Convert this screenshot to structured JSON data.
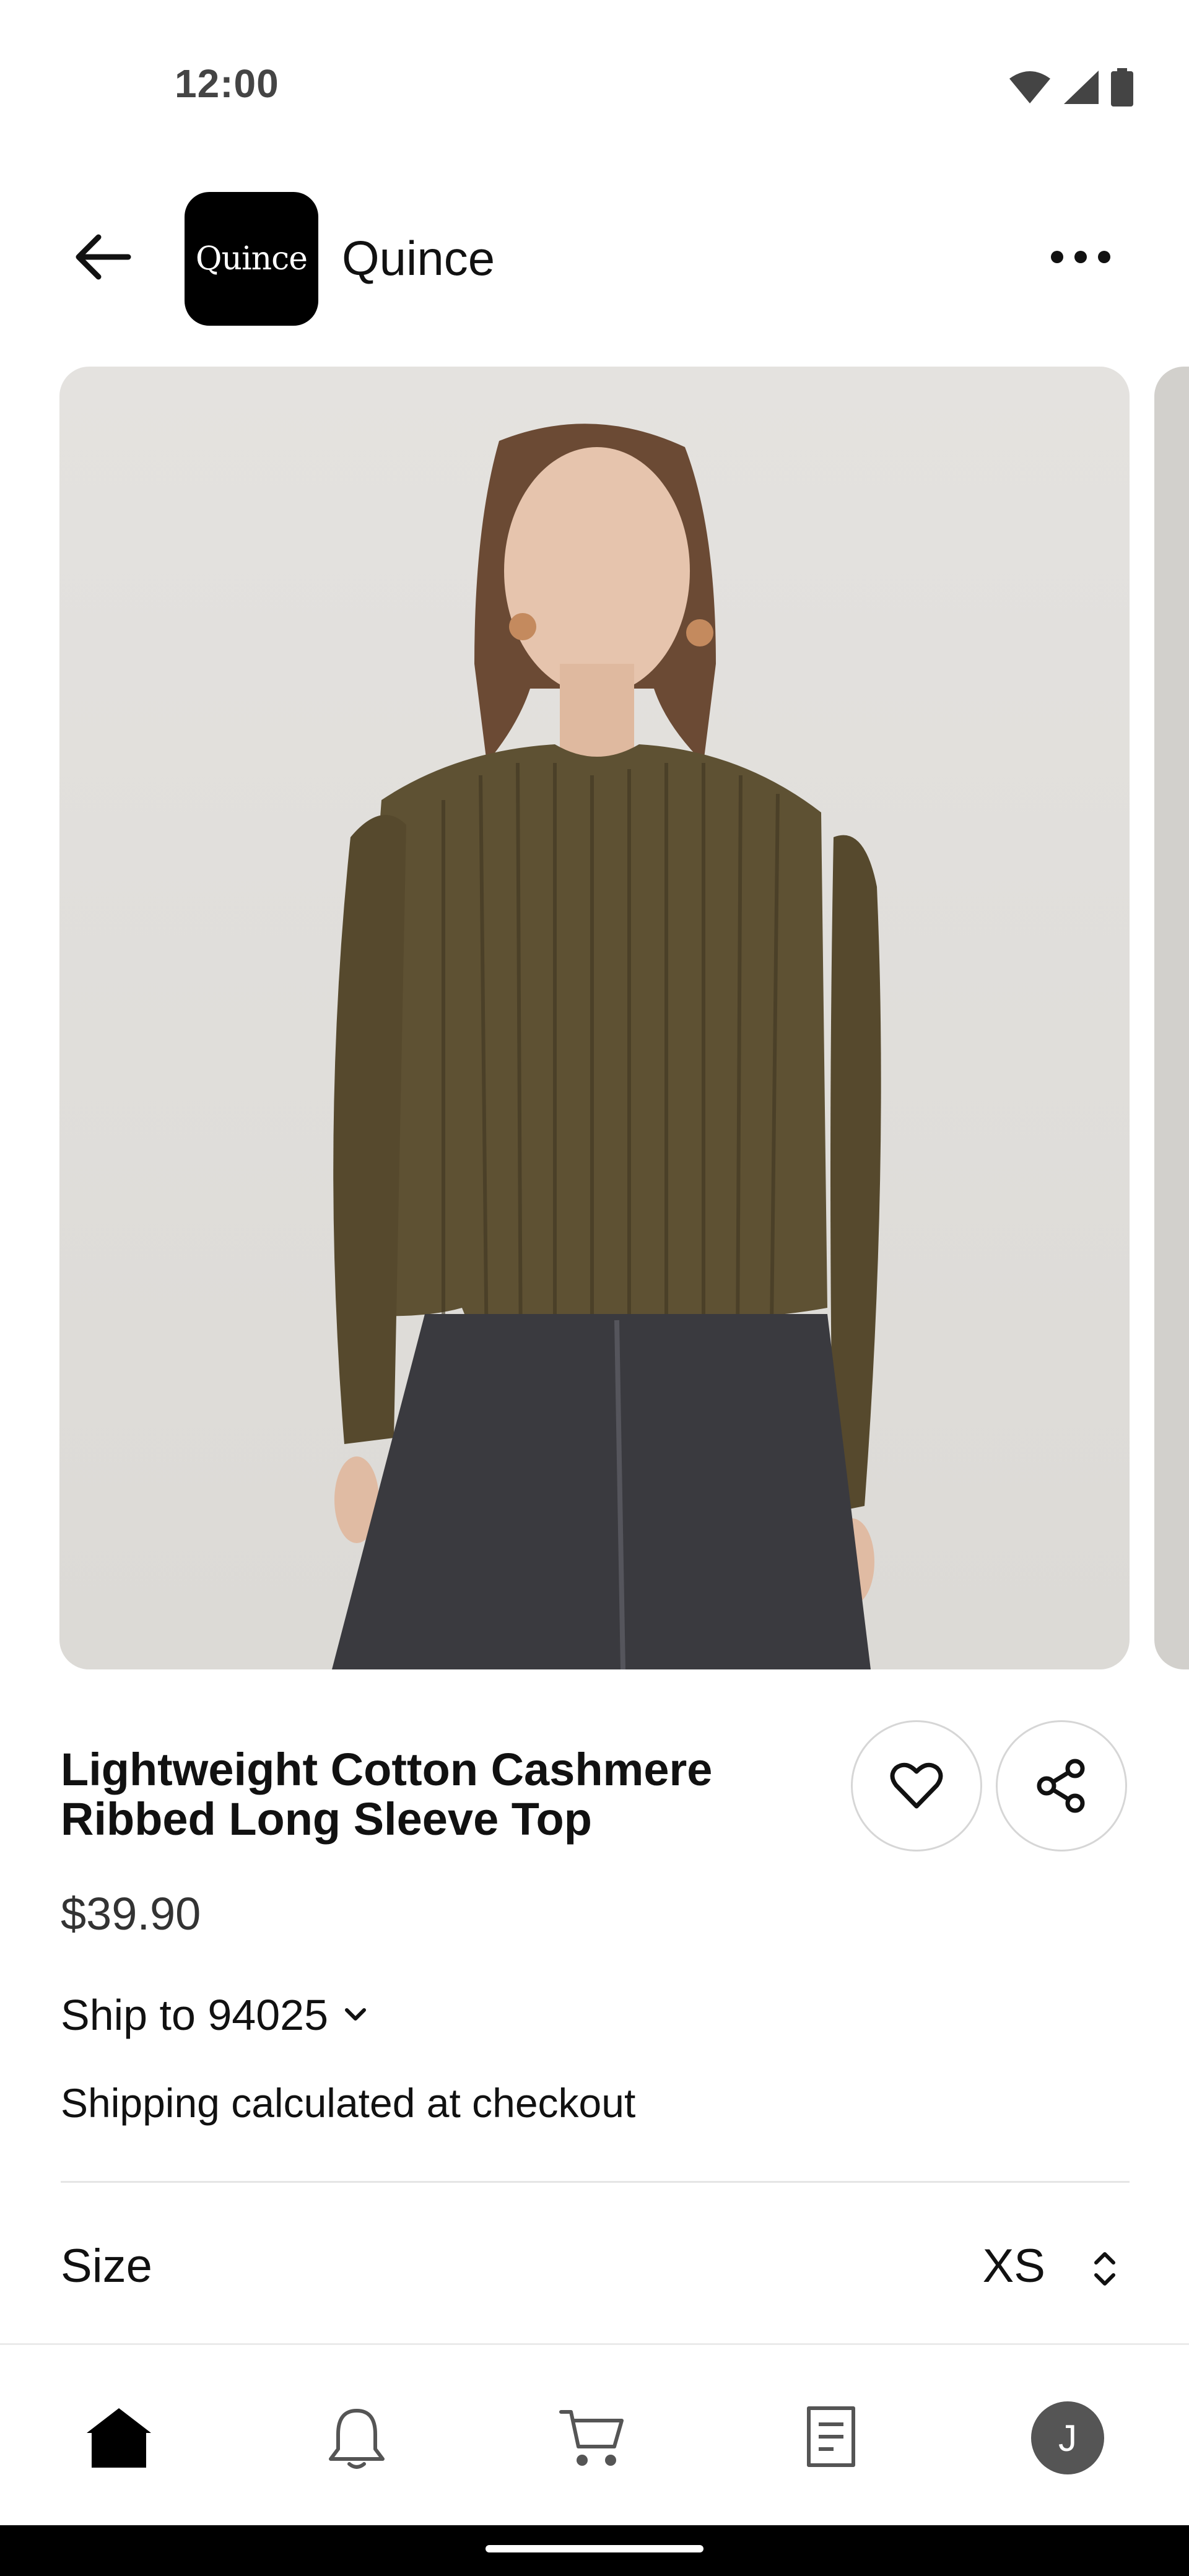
{
  "status_bar": {
    "time": "12:00",
    "icons": [
      "wifi-icon",
      "signal-icon",
      "battery-icon"
    ]
  },
  "header": {
    "back_icon": "arrow-left-icon",
    "logo_text": "Quince",
    "shop_name": "Quince",
    "more_icon": "more-horizontal-icon"
  },
  "product": {
    "image_subject": "product photo",
    "title": "Lightweight Cotton Cashmere Ribbed Long Sleeve Top",
    "price": "$39.90",
    "ship_to_label": "Ship to 94025",
    "shipping_note": "Shipping calculated at checkout",
    "size_label": "Size",
    "size_value": "XS"
  },
  "actions": {
    "favorite_icon": "heart-icon",
    "share_icon": "share-icon"
  },
  "bottom_nav": {
    "items": [
      {
        "icon": "home-icon",
        "active": true
      },
      {
        "icon": "bell-icon",
        "active": false
      },
      {
        "icon": "cart-icon",
        "active": false
      },
      {
        "icon": "receipt-icon",
        "active": false
      },
      {
        "icon": "avatar",
        "active": false
      }
    ],
    "avatar_initial": "J"
  },
  "colors": {
    "background": "#ffffff",
    "text": "#111111",
    "muted_text": "#333333",
    "divider": "#e5e5e5",
    "avatar_bg": "#555555",
    "sweater": "#5e5133",
    "skirt": "#3a3a3f"
  }
}
